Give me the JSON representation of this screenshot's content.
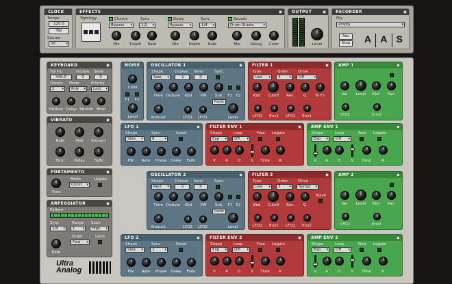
{
  "clock": {
    "title": "CLOCK",
    "tempo_label": "Tempo",
    "tempo_value": "120.0",
    "tap": "Tap",
    "source_label": "Source",
    "source_value": "Int"
  },
  "effects": {
    "title": "EFFECTS",
    "topology_label": "Topology",
    "chorus": {
      "label": "Chorus",
      "preset": "Bypass",
      "sync_label": "Sync",
      "sync_value": "1/2",
      "mix": "Mix",
      "depth": "Depth",
      "rate": "Rate"
    },
    "delay": {
      "label": "Delay",
      "preset": "Bypass",
      "sync_label": "Sync",
      "sync_value": "1/4",
      "mix": "Mix",
      "depth": "Depth",
      "rate": "Rate"
    },
    "reverb": {
      "label": "Reverb",
      "preset": "Drum Studio",
      "mix": "Mix",
      "decay": "Decay",
      "color": "Color"
    }
  },
  "output": {
    "title": "OUTPUT",
    "level": "Level"
  },
  "recorder": {
    "title": "RECORDER",
    "file_label": "File",
    "file_value": "empty",
    "rec": "Rec",
    "stop": "Stop",
    "logo_a1": "A",
    "logo_a2": "A",
    "logo_s": "S"
  },
  "keyboard": {
    "title": "KEYBOARD",
    "tuning_label": "Tuning",
    "tuning_value": "440.0",
    "octave_label": "Octave",
    "octave_value": "0",
    "semi_label": "Semi",
    "semi_value": "0",
    "unison_label": "Unison",
    "unison_value": "2",
    "mode_label": "Mode",
    "mode_value": "Poly",
    "priority_label": "Priority",
    "priority_value": "Last",
    "detune": "Detune",
    "delay": "Delay",
    "stretch": "Stretch",
    "error": "Error"
  },
  "vibrato": {
    "title": "VIBRATO",
    "rate": "Rate",
    "mod": "Mod",
    "amount": "Amount",
    "error": "Error",
    "delay": "Delay",
    "fade": "Fade"
  },
  "portamento": {
    "title": "PORTAMENTO",
    "mode_label": "Mode",
    "mode_value": "Const",
    "legato": "Legato",
    "time": "Time"
  },
  "arpeggiator": {
    "title": "ARPEGGIATOR",
    "pattern": "Pattern",
    "sync_label": "Sync",
    "sync_value": "1/4",
    "range_label": "Range",
    "range_value": "1",
    "span_label": "Span",
    "span_value": "High",
    "order_label": "Order",
    "order_value": "Fwd",
    "latch": "Latch",
    "rate": "Rate"
  },
  "logo": {
    "line1": "Ultra",
    "line2": "Analog"
  },
  "noise": {
    "title": "NOISE",
    "color": "Color",
    "f1": "F1",
    "f2": "F2",
    "level": "Level"
  },
  "osc1": {
    "title": "OSCILLATOR 1",
    "shape_label": "Shape",
    "shape_value": "Saw",
    "octave_label": "Octave",
    "octave_value": "-1",
    "semi_label": "Semi",
    "semi_value": "0",
    "sync": "Sync",
    "time": "Time",
    "detune": "Detune",
    "kbd": "Kbd",
    "pw": "PW",
    "sub": "Sub",
    "f1": "F1",
    "f2": "F2",
    "radio": "Radio",
    "amount": "Amount",
    "lfo1": "LFO1",
    "lfo1b": "LFO1",
    "level": "Level"
  },
  "filter1": {
    "title": "FILTER 1",
    "type_label": "Type",
    "type_value": "Low",
    "order_label": "Order",
    "order_value": "4",
    "drive_label": "Drive",
    "drive_value": "Off",
    "kbd": "Kbd",
    "cutoff": "Cutoff",
    "res": "Res",
    "q": "Q",
    "to_f2": "To F2",
    "lfo1": "LFO1",
    "env1": "Env1",
    "lfo1b": "LFO1",
    "env1b": "Env1"
  },
  "amp1": {
    "title": "AMP 1",
    "vel": "Vel",
    "level": "Level",
    "kbd": "Kbd",
    "pan": "Pan",
    "lfo1": "LFO1",
    "env1": "Env1"
  },
  "lfo1": {
    "title": "LFO 1",
    "shape_label": "Shape",
    "shape_value": "Sine",
    "sync_label": "Sync",
    "sync_value": "8",
    "reset": "Reset",
    "pw": "PW",
    "rate": "Rate",
    "phase": "Phase",
    "delay": "Delay",
    "fade": "Fade"
  },
  "fenv1": {
    "title": "FILTER ENV 1",
    "shape_label": "Shape",
    "shape_value": "Exp",
    "loop_label": "Loop",
    "loop_value": "Off",
    "free": "Free",
    "legato": "Legato",
    "v": "V",
    "a": "A",
    "d": "D",
    "s": "S",
    "time": "Time",
    "r": "R"
  },
  "aenv1": {
    "title": "AMP ENV 1",
    "shape_label": "Shape",
    "shape_value": "Exp",
    "loop_label": "Loop",
    "loop_value": "Off",
    "free": "Free",
    "legato": "Legato",
    "v": "V",
    "a": "A",
    "d": "D",
    "s": "S",
    "time": "Time",
    "r": "R"
  },
  "osc2": {
    "title": "OSCILLATOR 2",
    "shape_label": "Shape",
    "shape_value": "Rect",
    "octave_label": "Octave",
    "octave_value": "-1",
    "semi_label": "Semi",
    "semi_value": "0",
    "sync": "Sync",
    "time": "Time",
    "detune": "Detune",
    "kbd": "Kbd",
    "pw": "PW",
    "sub": "Sub",
    "f1": "F1",
    "f2": "F2",
    "radio": "Radio",
    "amount": "Amount",
    "lfo2": "LFO2",
    "lfo2b": "LFO2",
    "level": "Level"
  },
  "filter2": {
    "title": "FILTER 2",
    "type_label": "Type",
    "type_value": "Low",
    "order_label": "Order",
    "order_value": "2",
    "drive_label": "Drive",
    "drive_value": "Sympt",
    "kbd": "Kbd",
    "cutoff": "Cutoff",
    "res": "Res",
    "q": "Q",
    "slave": "Slave",
    "lfo2": "LFO2",
    "env2": "Env2",
    "lfo2b": "LFO2",
    "env2b": "Env2"
  },
  "amp2": {
    "title": "AMP 2",
    "vel": "Vel",
    "level": "Level",
    "kbd": "Kbd",
    "pan": "Pan",
    "lfo2": "LFO2",
    "env2": "Env2"
  },
  "lfo2": {
    "title": "LFO 2",
    "shape_label": "Shape",
    "shape_value": "Sine",
    "sync_label": "Sync",
    "sync_value": "1",
    "reset": "Reset",
    "pw": "PW",
    "rate": "Rate",
    "phase": "Phase",
    "delay": "Delay",
    "fade": "Fade"
  },
  "fenv2": {
    "title": "FILTER ENV 2",
    "shape_label": "Shape",
    "shape_value": "Exp",
    "loop_label": "Loop",
    "loop_value": "Off",
    "free": "Free",
    "legato": "Legato",
    "v": "V",
    "a": "A",
    "d": "D",
    "s": "S",
    "time": "Time",
    "r": "R"
  },
  "aenv2": {
    "title": "AMP ENV 2",
    "shape_label": "Shape",
    "shape_value": "Exp",
    "loop_label": "Loop",
    "loop_value": "Off",
    "free": "Free",
    "legato": "Legato",
    "v": "V",
    "a": "A",
    "d": "D",
    "s": "S",
    "time": "Time",
    "r": "R"
  }
}
